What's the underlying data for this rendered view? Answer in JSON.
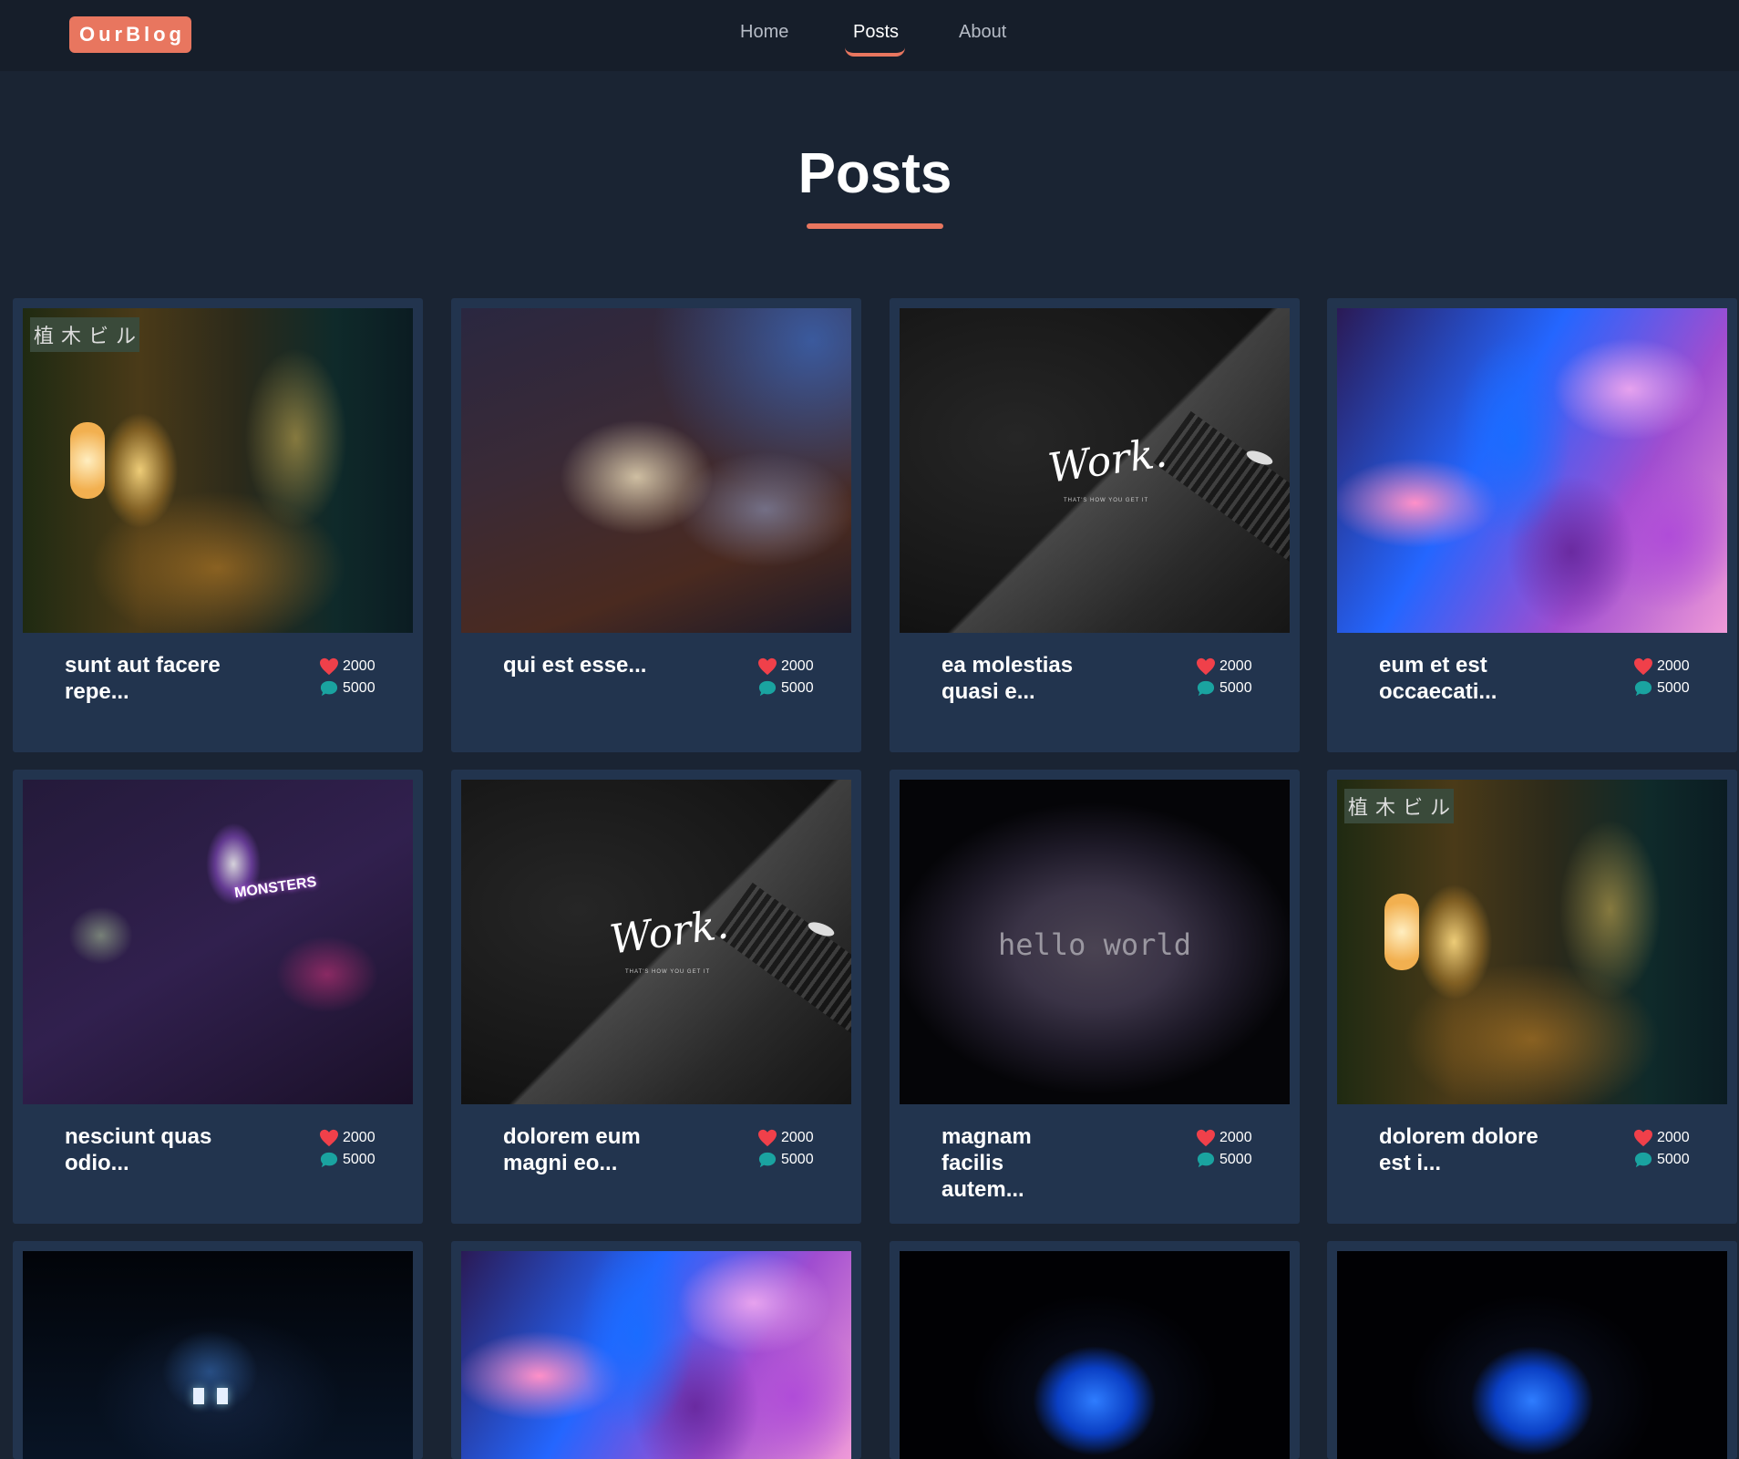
{
  "brand": {
    "logo": "OurBlog",
    "accent": "#e8765f"
  },
  "nav": {
    "items": [
      {
        "label": "Home",
        "active": false
      },
      {
        "label": "Posts",
        "active": true
      },
      {
        "label": "About",
        "active": false
      }
    ]
  },
  "page": {
    "title": "Posts"
  },
  "posts": [
    {
      "title": "sunt aut facere repe...",
      "likes": "2000",
      "comments": "5000",
      "image": "night-alley"
    },
    {
      "title": "qui est esse...",
      "likes": "2000",
      "comments": "5000",
      "image": "cozy-room"
    },
    {
      "title": "ea molestias quasi e...",
      "likes": "2000",
      "comments": "5000",
      "image": "work-laptop",
      "image_text": "Work.",
      "image_subtext": "THAT'S HOW YOU GET IT"
    },
    {
      "title": "eum et est occaecati...",
      "likes": "2000",
      "comments": "5000",
      "image": "fluid-marble"
    },
    {
      "title": "nesciunt quas odio...",
      "likes": "2000",
      "comments": "5000",
      "image": "neon-monsters-room",
      "image_text": "MONSTERS"
    },
    {
      "title": "dolorem eum magni eo...",
      "likes": "2000",
      "comments": "5000",
      "image": "work-laptop",
      "image_text": "Work.",
      "image_subtext": "THAT'S HOW YOU GET IT"
    },
    {
      "title": "magnam facilis autem...",
      "likes": "2000",
      "comments": "5000",
      "image": "hello-world",
      "image_text": "hello world"
    },
    {
      "title": "dolorem dolore est i...",
      "likes": "2000",
      "comments": "5000",
      "image": "night-alley"
    },
    {
      "title": "",
      "likes": "",
      "comments": "",
      "image": "dark-window"
    },
    {
      "title": "",
      "likes": "",
      "comments": "",
      "image": "fluid-marble"
    },
    {
      "title": "",
      "likes": "",
      "comments": "",
      "image": "blue-bloom"
    },
    {
      "title": "",
      "likes": "",
      "comments": "",
      "image": "blue-bloom"
    }
  ],
  "icons": {
    "like": "heart-icon",
    "comment": "comment-bubble-icon"
  },
  "colors": {
    "background": "#1a2433",
    "navbar": "#161e2a",
    "card": "#22344e",
    "like": "#f0404a",
    "comment": "#1aa3a0"
  }
}
